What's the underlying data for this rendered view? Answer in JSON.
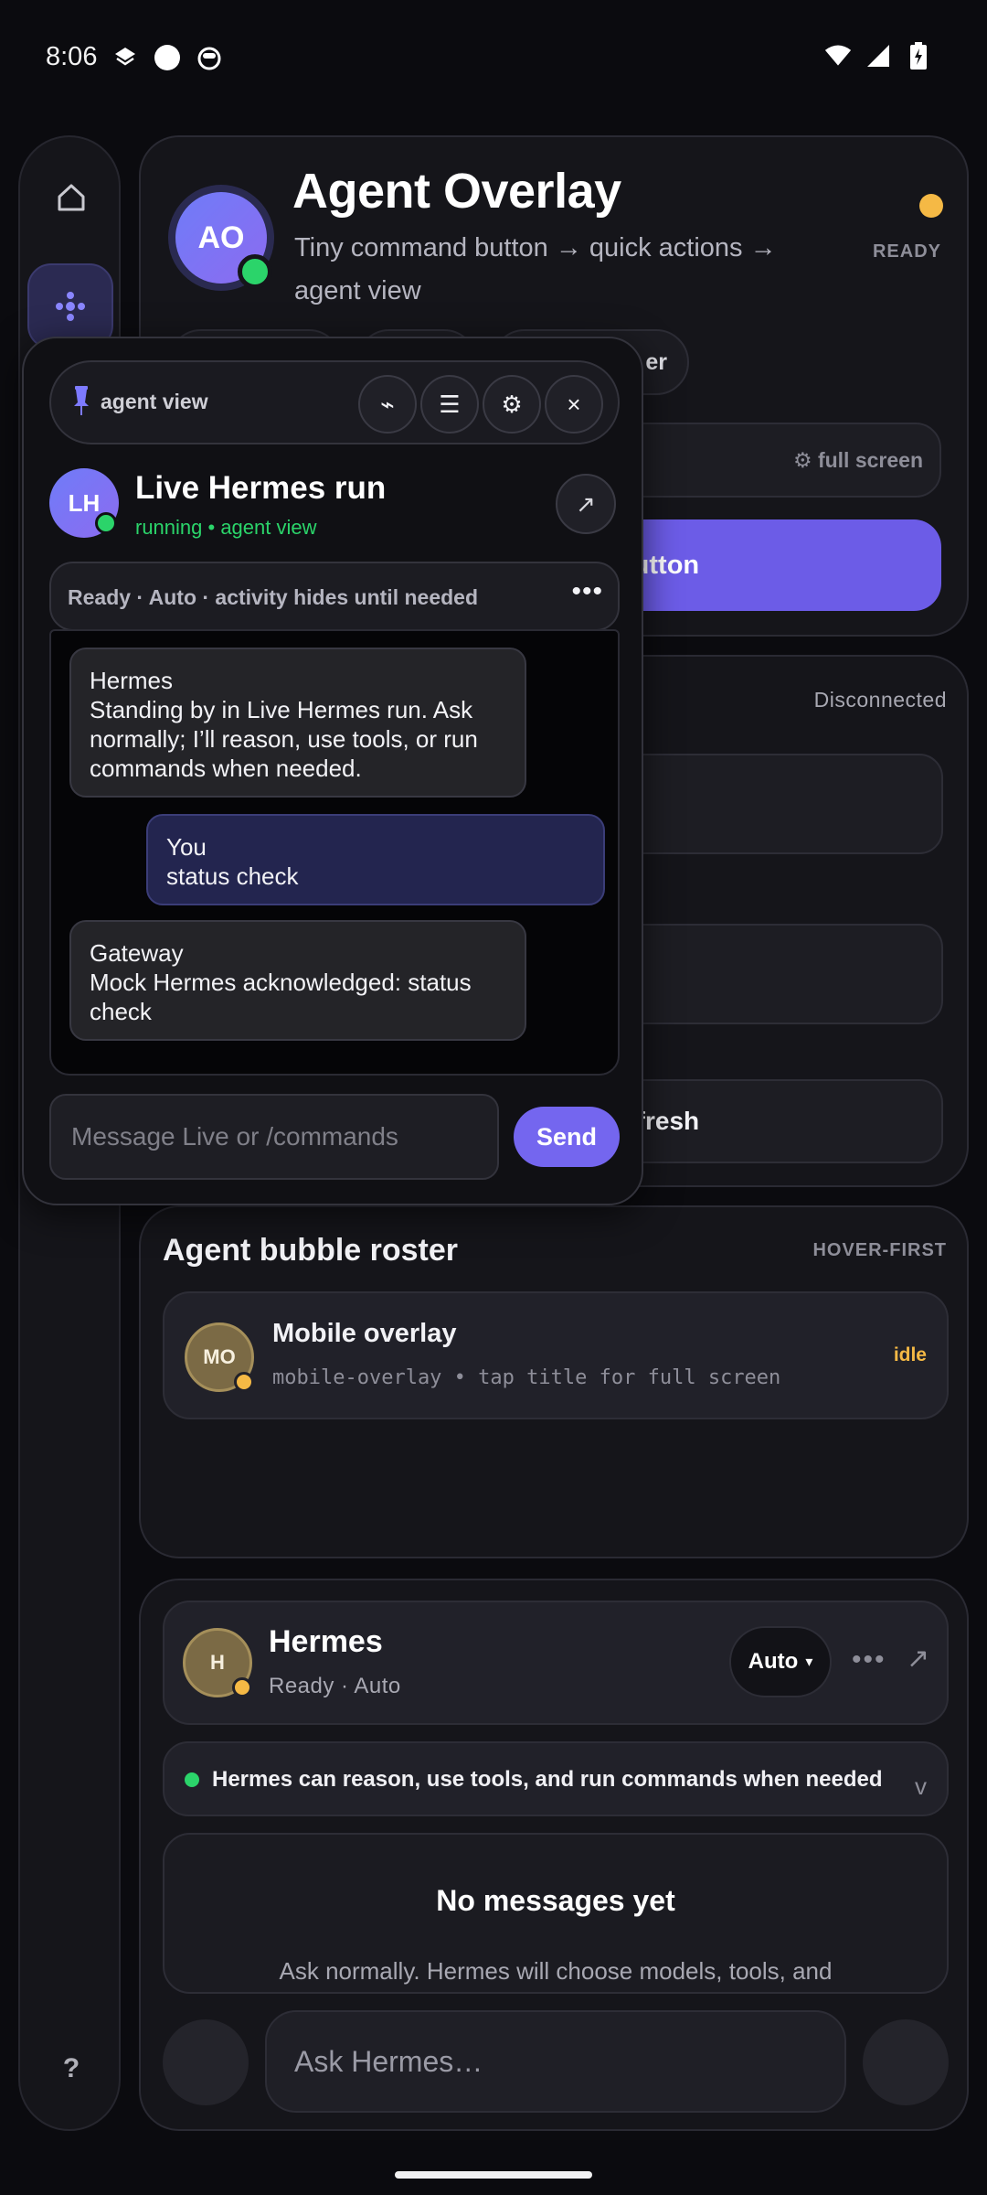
{
  "status_bar": {
    "time": "8:06",
    "left_icons": [
      "layers-icon",
      "circle-icon",
      "cat-face-icon"
    ],
    "right_icons": [
      "wifi-icon",
      "signal-icon",
      "battery-charging-icon"
    ]
  },
  "rail": {
    "items": [
      "home-icon",
      "agents-icon"
    ],
    "help": "?"
  },
  "agent_overlay_card": {
    "avatar": "AO",
    "title": "Agent Overlay",
    "subtitle": "Tiny command button → quick actions → agent view",
    "status": "READY",
    "chip_visible": "er",
    "full_screen": "⚙ full screen",
    "command_button": "l button"
  },
  "connection_card": {
    "status": "Disconnected",
    "refresh": "Refresh"
  },
  "roster": {
    "title": "Agent bubble roster",
    "tag": "HOVER-FIRST",
    "item": {
      "avatar": "MO",
      "title": "Mobile overlay",
      "subtitle": "mobile-overlay • tap title for full screen",
      "status": "idle"
    }
  },
  "hermes": {
    "avatar": "H",
    "title": "Hermes",
    "subtitle": "Ready · Auto",
    "mode": "Auto",
    "mode_caret": "▾",
    "more": "•••",
    "expand": "↗",
    "capability": "Hermes can reason, use tools, and run commands when needed",
    "capability_chevron": "v",
    "empty_title": "No messages yet",
    "empty_subtitle": "Ask normally. Hermes will choose models, tools, and",
    "input_placeholder": "Ask Hermes…"
  },
  "overlay": {
    "bar_label": "agent view",
    "bar_buttons": [
      "⌁",
      "☰",
      "⚙",
      "×"
    ],
    "avatar": "LH",
    "title": "Live Hermes run",
    "subtitle": "running • agent view",
    "expand": "↗",
    "status": "Ready · Auto · activity hides until needed",
    "status_more": "•••",
    "messages": [
      {
        "sender": "Hermes",
        "text": "Standing by in Live Hermes run. Ask normally; I’ll reason, use tools, or run commands when needed."
      },
      {
        "sender": "You",
        "text": "status check"
      },
      {
        "sender": "Gateway",
        "text": "Mock Hermes acknowledged: status check"
      }
    ],
    "input_placeholder": "Message Live or /commands",
    "send": "Send"
  },
  "colors": {
    "accent": "#6c5ce7",
    "online": "#2bd46a",
    "idle": "#f5b945",
    "background": "#0b0b0f"
  }
}
